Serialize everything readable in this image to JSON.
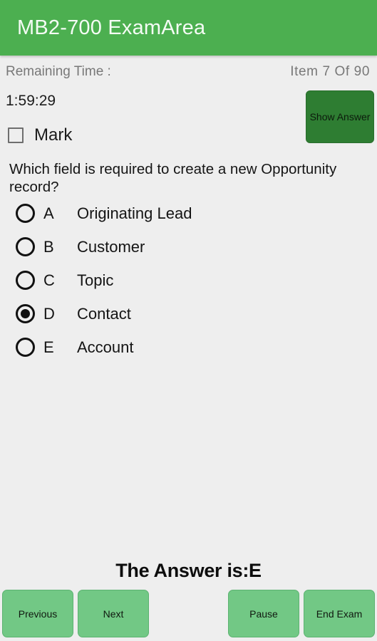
{
  "appbar": {
    "title": "MB2-700 ExamArea",
    "background": "#4caf50",
    "text_color": "#f4fbf4"
  },
  "status": {
    "remaining_time_label": "Remaining Time :",
    "item_counter": "Item 7 Of 90",
    "timer_value": "1:59:29"
  },
  "mark": {
    "label": "Mark",
    "checked": false
  },
  "show_answer": {
    "label": "Show Answer",
    "background": "#2e7d32"
  },
  "question": {
    "text": "Which field is required to create a new Opportunity record?"
  },
  "options": [
    {
      "letter": "A",
      "text": "Originating Lead",
      "selected": false
    },
    {
      "letter": "B",
      "text": "Customer",
      "selected": false
    },
    {
      "letter": "C",
      "text": "Topic",
      "selected": false
    },
    {
      "letter": "D",
      "text": "Contact",
      "selected": true
    },
    {
      "letter": "E",
      "text": "Account",
      "selected": false
    }
  ],
  "answer_reveal": {
    "text": "The Answer is:E"
  },
  "buttons": {
    "previous": "Previous",
    "next": "Next",
    "pause": "Pause",
    "end_exam": "End Exam",
    "background": "#72c885"
  }
}
